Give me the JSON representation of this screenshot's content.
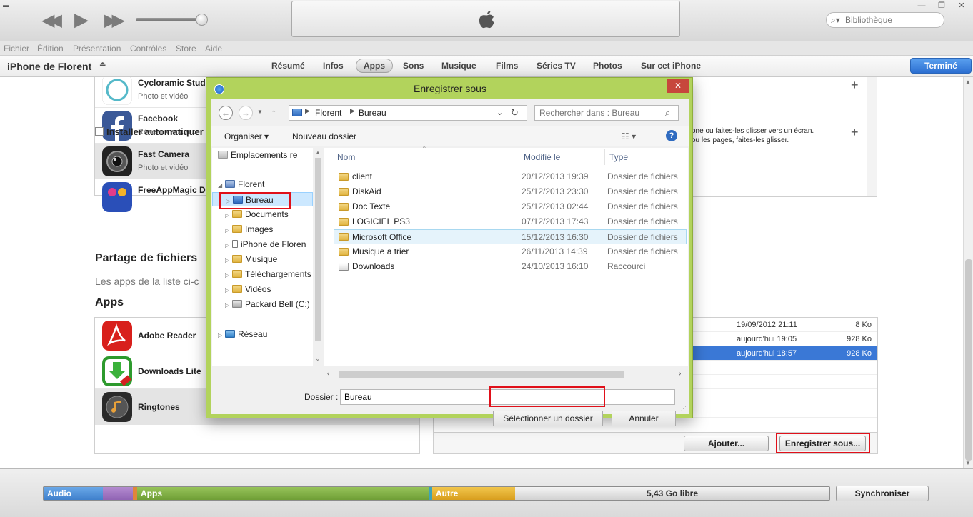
{
  "titlebar": {
    "search_placeholder": "Bibliothèque"
  },
  "menubar": [
    "Fichier",
    "Édition",
    "Présentation",
    "Contrôles",
    "Store",
    "Aide"
  ],
  "device": {
    "name": "iPhone de Florent",
    "tabs": [
      "Résumé",
      "Infos",
      "Apps",
      "Sons",
      "Musique",
      "Films",
      "Séries TV",
      "Photos",
      "Sur cet iPhone"
    ],
    "active_tab": "Apps",
    "done_label": "Terminé"
  },
  "top_apps": [
    {
      "name": "Cycloramic Studio",
      "category": "Photo et vidéo"
    },
    {
      "name": "Facebook",
      "category": "Réseaux sociaux"
    },
    {
      "name": "Fast Camera",
      "category": "Photo et vidéo"
    },
    {
      "name": "FreeAppMagic D"
    }
  ],
  "auto_install_label": "Installer automatiquer",
  "homescreen_hint": [
    "one ou faites-les glisser vers un écran.",
    "ou les pages, faites-les glisser."
  ],
  "sharing": {
    "title": "Partage de fichiers",
    "description": "Les apps de la liste ci-c",
    "apps_title": "Apps",
    "apps": [
      {
        "name": "Adobe Reader"
      },
      {
        "name": "Downloads Lite"
      },
      {
        "name": "Ringtones"
      }
    ],
    "files": [
      {
        "date": "19/09/2012 21:11",
        "size": "8 Ko"
      },
      {
        "date": "aujourd'hui 19:05",
        "size": "928 Ko"
      },
      {
        "date": "aujourd'hui 18:57",
        "size": "928 Ko"
      }
    ],
    "add_label": "Ajouter...",
    "save_as_label": "Enregistrer sous..."
  },
  "capacity": {
    "audio_label": "Audio",
    "apps_label": "Apps",
    "other_label": "Autre",
    "free_label": "5,43 Go libre",
    "sync_label": "Synchroniser"
  },
  "dialog": {
    "title": "Enregistrer sous",
    "close_label": "✕",
    "breadcrumb": [
      "Florent",
      "Bureau"
    ],
    "search_placeholder": "Rechercher dans : Bureau",
    "organize_label": "Organiser",
    "new_folder_label": "Nouveau dossier",
    "tree": [
      {
        "label": "Emplacements re"
      },
      {
        "label": "Florent"
      },
      {
        "label": "Bureau"
      },
      {
        "label": "Documents"
      },
      {
        "label": "Images"
      },
      {
        "label": "iPhone de Floren"
      },
      {
        "label": "Musique"
      },
      {
        "label": "Téléchargements"
      },
      {
        "label": "Vidéos"
      },
      {
        "label": "Packard Bell (C:)"
      },
      {
        "label": "Réseau"
      }
    ],
    "columns": {
      "name": "Nom",
      "modified": "Modifié le",
      "type": "Type"
    },
    "files": [
      {
        "name": "client",
        "modified": "20/12/2013 19:39",
        "type": "Dossier de fichiers"
      },
      {
        "name": "DiskAid",
        "modified": "25/12/2013 23:30",
        "type": "Dossier de fichiers"
      },
      {
        "name": "Doc Texte",
        "modified": "25/12/2013 02:44",
        "type": "Dossier de fichiers"
      },
      {
        "name": "LOGICIEL PS3",
        "modified": "07/12/2013 17:43",
        "type": "Dossier de fichiers"
      },
      {
        "name": "Microsoft Office",
        "modified": "15/12/2013 16:30",
        "type": "Dossier de fichiers"
      },
      {
        "name": "Musique a trier",
        "modified": "26/11/2013 14:39",
        "type": "Dossier de fichiers"
      },
      {
        "name": "Downloads",
        "modified": "24/10/2013 16:10",
        "type": "Raccourci"
      }
    ],
    "folder_label": "Dossier :",
    "folder_value": "Bureau",
    "select_folder_label": "Sélectionner un dossier",
    "cancel_label": "Annuler"
  },
  "colors": {
    "audio": "#4b8fd6",
    "apps": "#7fb045",
    "other": "#e2b43a",
    "dialog_frame": "#b2d35c",
    "highlight": "#e0101a",
    "selection": "#3a78d6"
  }
}
